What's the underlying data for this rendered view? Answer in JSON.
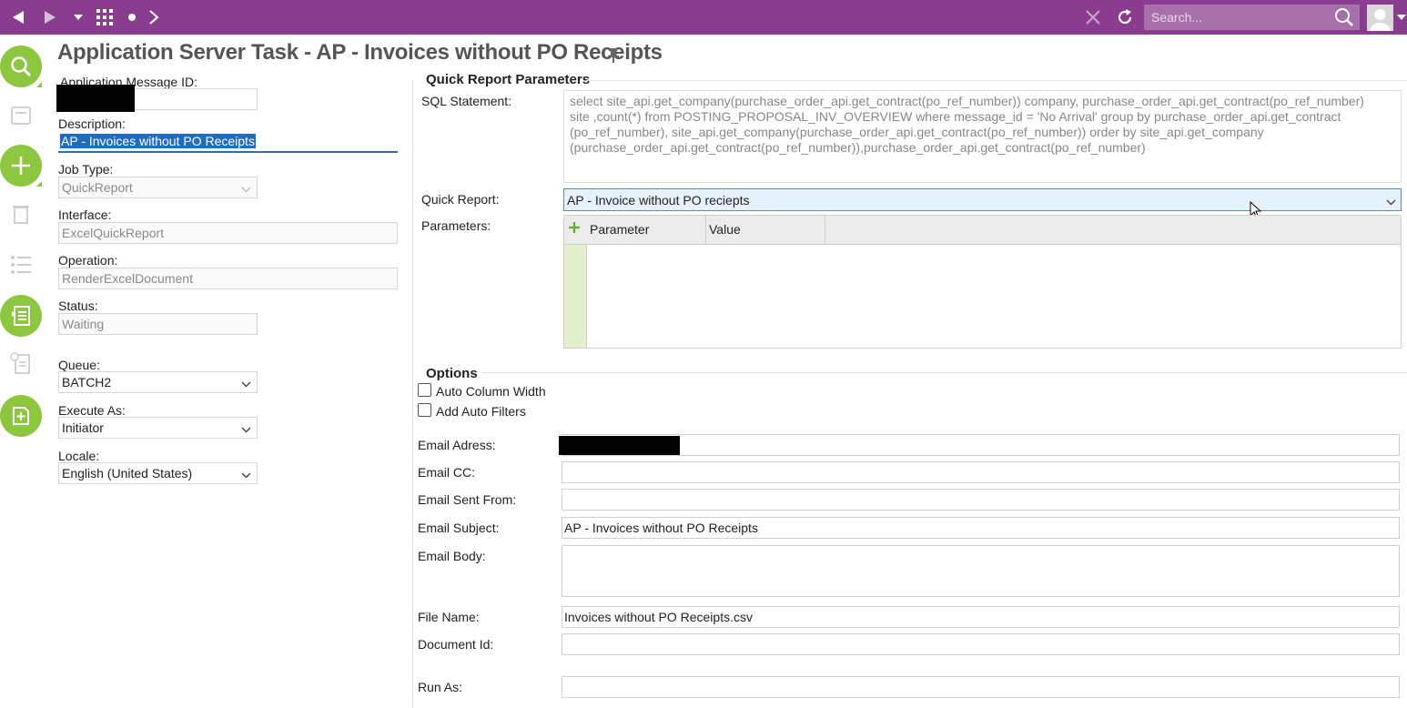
{
  "topbar": {
    "search_placeholder": "Search...",
    "icons": [
      "back-arrow-icon",
      "forward-arrow-icon",
      "dropdown-icon",
      "apps-grid-icon",
      "dot-icon",
      "chevron-right-icon",
      "close-icon",
      "refresh-icon",
      "search-icon",
      "user-avatar-icon"
    ],
    "color": "#8a3d8f"
  },
  "sidebar": {
    "accent": "#8dc63f",
    "buttons": [
      "search-icon",
      "new-icon",
      "list-icon",
      "new-document-icon"
    ],
    "inactive_icons": [
      "save-icon",
      "delete-icon",
      "bullet-list-icon",
      "info-document-icon"
    ]
  },
  "page": {
    "title": "Application Server Task - AP - Invoices without PO Receipts"
  },
  "form": {
    "app_message_id_label": "Application Message ID:",
    "description_label": "Description:",
    "description_value": "AP - Invoices without PO Receipts",
    "job_type_label": "Job Type:",
    "job_type_value": "QuickReport",
    "interface_label": "Interface:",
    "interface_value": "ExcelQuickReport",
    "operation_label": "Operation:",
    "operation_value": "RenderExcelDocument",
    "status_label": "Status:",
    "status_value": "Waiting",
    "queue_label": "Queue:",
    "queue_value": "BATCH2",
    "execute_as_label": "Execute As:",
    "execute_as_value": "Initiator",
    "locale_label": "Locale:",
    "locale_value": "English (United States)"
  },
  "quick_report": {
    "section_title": "Quick Report Parameters",
    "sql_label": "SQL Statement:",
    "sql_lines": [
      "select   site_api.get_company(purchase_order_api.get_contract(po_ref_number)) company, purchase_order_api.get_contract(po_ref_number)",
      "site ,count(*) from POSTING_PROPOSAL_INV_OVERVIEW  where message_id = 'No Arrival' group by  purchase_order_api.get_contract",
      "(po_ref_number),  site_api.get_company(purchase_order_api.get_contract(po_ref_number)) order by   site_api.get_company",
      "(purchase_order_api.get_contract(po_ref_number)),purchase_order_api.get_contract(po_ref_number)"
    ],
    "quick_report_label": "Quick Report:",
    "quick_report_value": "AP - Invoice without PO reciepts",
    "parameters_label": "Parameters:",
    "grid_columns": [
      "Parameter",
      "Value"
    ]
  },
  "options": {
    "section_title": "Options",
    "auto_column_width": "Auto Column Width",
    "add_auto_filters": "Add Auto Filters",
    "auto_column_width_checked": false,
    "add_auto_filters_checked": false,
    "email_address_label": "Email Adress:",
    "email_cc_label": "Email CC:",
    "email_sent_from_label": "Email Sent From:",
    "email_subject_label": "Email Subject:",
    "email_subject_value": "AP - Invoices without PO Receipts",
    "email_body_label": "Email Body:",
    "file_name_label": "File Name:",
    "file_name_value": "Invoices without PO Receipts.csv",
    "document_id_label": "Document Id:",
    "run_as_label": "Run As:"
  }
}
